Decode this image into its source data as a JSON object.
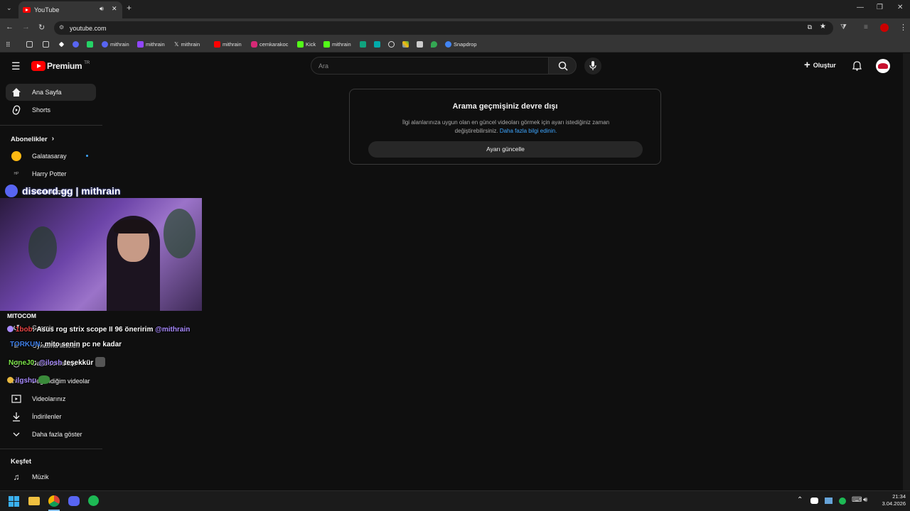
{
  "browser": {
    "tab_title": "YouTube",
    "url": "youtube.com",
    "bookmarks": [
      "mithrain",
      "mithrain",
      "mithrain",
      "mithrain",
      "cemkarakoc",
      "Kick",
      "mithrain",
      "Snapdrop"
    ]
  },
  "header": {
    "logo_text": "Premium",
    "logo_region": "TR",
    "search_placeholder": "Ara",
    "create_label": "Oluştur"
  },
  "sidebar": {
    "home": "Ana Sayfa",
    "shorts": "Shorts",
    "subscriptions_title": "Abonelikler",
    "subscriptions": [
      "Galatasaray",
      "Harry Potter",
      "Oikun Işımai"
    ],
    "you_items": [
      "Geçmiş",
      "Oynatma listeleri",
      "Daha sonra izle",
      "Beğendiğim videolar",
      "Videolarınız",
      "İndirilenler",
      "Daha fazla göster"
    ],
    "explore_title": "Keşfet",
    "explore_items": [
      "Müzik"
    ]
  },
  "card": {
    "title": "Arama geçmişiniz devre dışı",
    "body": "İlgi alanlarınıza uygun olan en güncel videoları görmek için ayarı istediğiniz zaman değiştirebilirsiniz.",
    "link": "Daha fazla bilgi edinin.",
    "button": "Ayarı güncelle"
  },
  "overlay": {
    "discord_text": "discord.gg | mithrain",
    "channel_label": "MITOCOM",
    "chat": [
      {
        "user": "1bob",
        "msg": ": Asus rog strix scope II 96 öneririm",
        "mention": "@mithrain",
        "user_color": "#e84545"
      },
      {
        "user": "TORKUN",
        "msg": ": mito senin pc ne kadar",
        "mention": "",
        "user_color": "#3f7fe8"
      },
      {
        "user": "NoneJ0",
        "msg": ": ",
        "mention": "@ilosh",
        "tail": " teşekkür",
        "user_color": "#7ee84a"
      },
      {
        "user": "ilgshu",
        "msg": "",
        "mention": "",
        "user_color": "#a98bff"
      }
    ]
  },
  "taskbar": {
    "time": "21:34",
    "date": "3.04.2026"
  },
  "colors": {
    "yt_red": "#ff0000",
    "link_blue": "#3ea6ff",
    "bg": "#0f0f0f"
  }
}
